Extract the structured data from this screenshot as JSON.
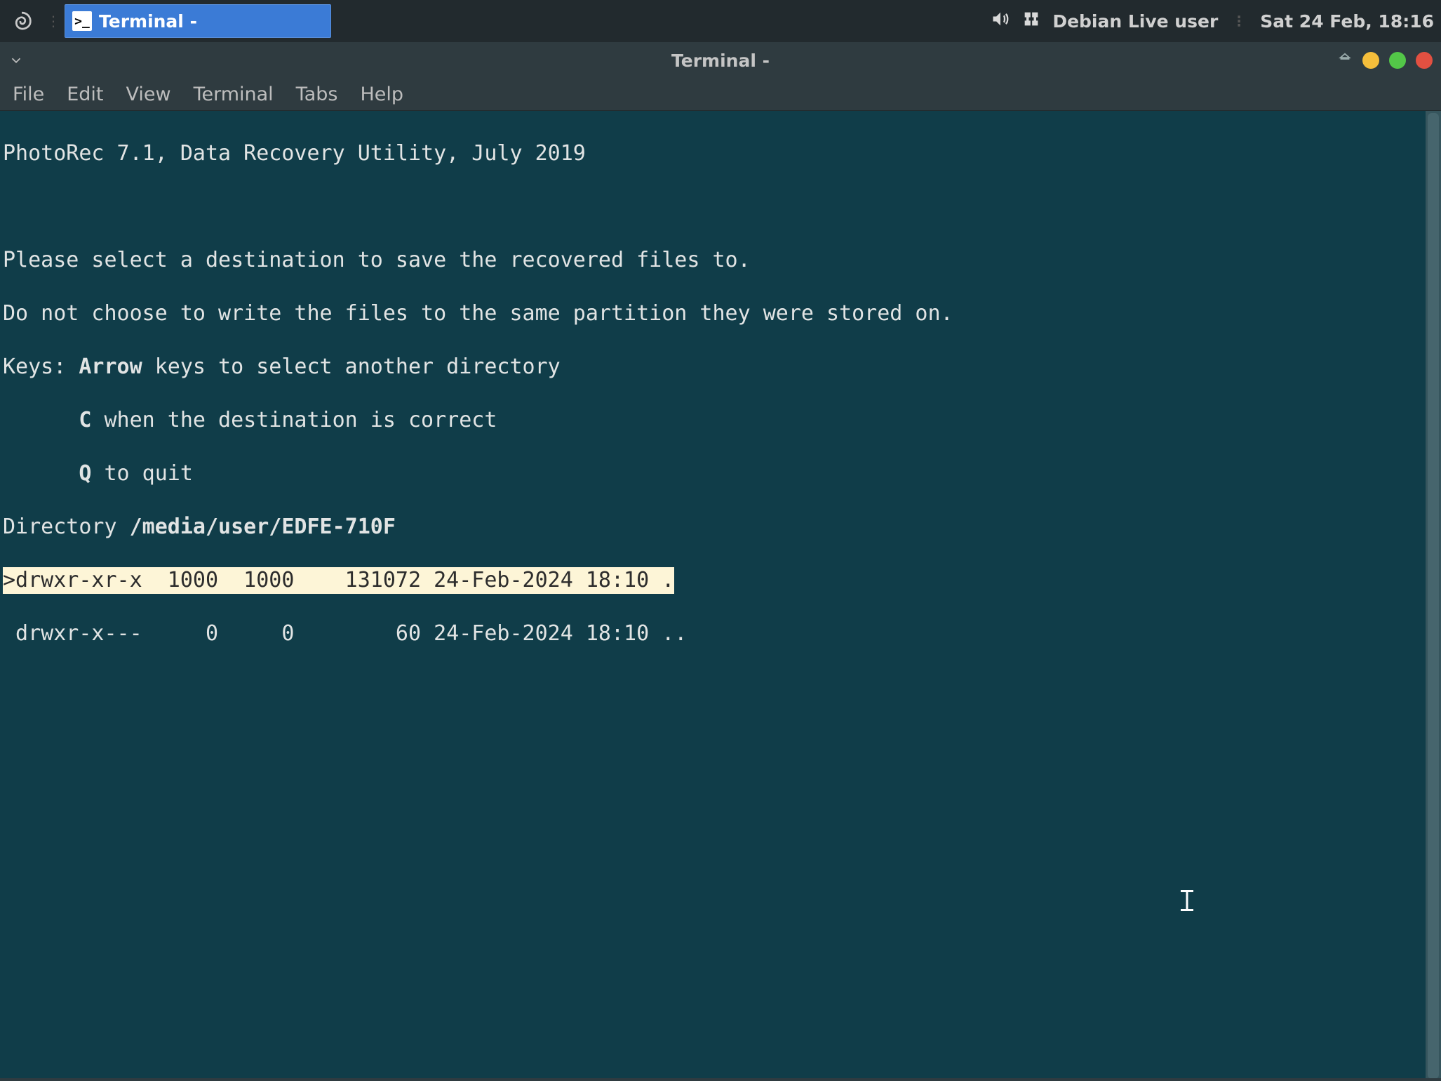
{
  "panel": {
    "taskbar_item_label": "Terminal -",
    "user_label": "Debian Live user",
    "datetime_label": "Sat 24 Feb, 18:16"
  },
  "window": {
    "title": "Terminal -",
    "menus": {
      "file": "File",
      "edit": "Edit",
      "view": "View",
      "terminal": "Terminal",
      "tabs": "Tabs",
      "help": "Help"
    }
  },
  "terminal": {
    "header_line": "PhotoRec 7.1, Data Recovery Utility, July 2019",
    "instr_line1": "Please select a destination to save the recovered files to.",
    "instr_line2": "Do not choose to write the files to the same partition they were stored on.",
    "keys_label": "Keys: ",
    "arrow_label": "Arrow",
    "arrow_text": " keys to select another directory",
    "c_label": "C",
    "c_text": " when the destination is correct",
    "q_label": "Q",
    "q_text": " to quit",
    "directory_label": "Directory ",
    "directory_path": "/media/user/EDFE-710F",
    "listing": {
      "rows": [
        {
          "selected": true,
          "marker": ">",
          "perms": "drwxr-xr-x",
          "uid": "1000",
          "gid": "1000",
          "size": "131072",
          "date": "24-Feb-2024 18:10",
          "name": "."
        },
        {
          "selected": false,
          "marker": " ",
          "perms": "drwxr-x---",
          "uid": "0",
          "gid": "0",
          "size": "60",
          "date": "24-Feb-2024 18:10",
          "name": ".."
        }
      ]
    },
    "row0_text": ">drwxr-xr-x  1000  1000    131072 24-Feb-2024 18:10 .",
    "row1_text": " drwxr-x---     0     0        60 24-Feb-2024 18:10 .."
  }
}
